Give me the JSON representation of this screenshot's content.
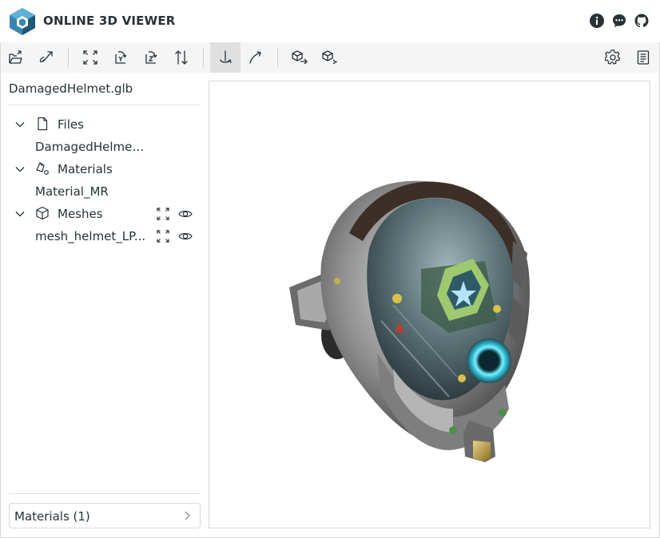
{
  "app": {
    "title": "ONLINE 3D VIEWER",
    "header_icons": [
      "info-icon",
      "feedback-icon",
      "github-icon"
    ]
  },
  "toolbar": {
    "buttons": [
      {
        "name": "open-button",
        "icon": "open-folder-icon"
      },
      {
        "name": "open-url-button",
        "icon": "link-icon"
      },
      {
        "name": "fit-to-window-button",
        "icon": "fit-icon"
      },
      {
        "name": "set-up-y-button",
        "icon": "rotate-y-icon"
      },
      {
        "name": "set-up-z-button",
        "icon": "rotate-z-icon"
      },
      {
        "name": "flip-up-button",
        "icon": "flip-icon"
      },
      {
        "name": "fixed-up-vector-button",
        "icon": "fixed-up-icon",
        "selected": true
      },
      {
        "name": "free-orbit-button",
        "icon": "free-orbit-icon"
      },
      {
        "name": "export-button",
        "icon": "export-icon"
      },
      {
        "name": "share-button",
        "icon": "share-icon"
      },
      {
        "name": "settings-button",
        "icon": "gear-icon"
      },
      {
        "name": "details-panel-button",
        "icon": "details-icon"
      }
    ]
  },
  "navigator": {
    "file_name": "DamagedHelmet.glb",
    "files": {
      "label": "Files",
      "items": [
        "DamagedHelmet.glb"
      ]
    },
    "materials": {
      "label": "Materials",
      "items": [
        "Material_MR"
      ]
    },
    "meshes": {
      "label": "Meshes",
      "items": [
        "mesh_helmet_LP..."
      ]
    }
  },
  "details": {
    "label": "Materials (1)"
  },
  "colors": {
    "accent": "#263238",
    "logo_blue": "#3393bd",
    "toolbar_bg": "#f5f5f5",
    "selected_bg": "#e0e0e0",
    "border": "#d8d8d8"
  }
}
